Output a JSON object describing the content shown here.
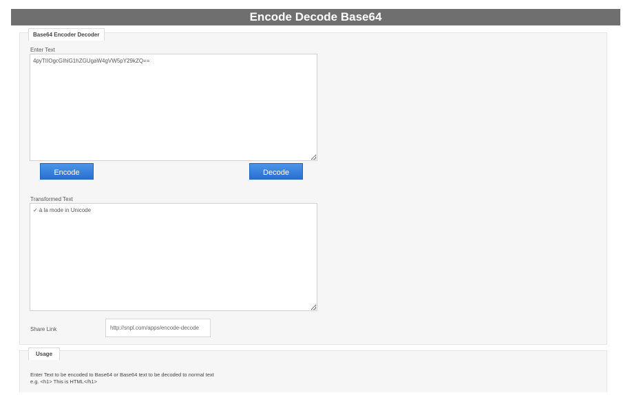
{
  "header": {
    "title": "Encode Decode Base64"
  },
  "panel": {
    "legend": "Base64 Encoder Decoder"
  },
  "input": {
    "label": "Enter Text",
    "value": "4pyTIIOgcGIhiG1hZGUgaW4gVW5pY29kZQ=="
  },
  "buttons": {
    "encode_label": "Encode",
    "decode_label": "Decode"
  },
  "output": {
    "label": "Transformed Text",
    "value": "✓ à la mode in Unicode"
  },
  "share": {
    "label": "Share Link",
    "value": "http://snpl.com/apps/encode-decode"
  },
  "usage": {
    "legend": "Usage",
    "line1": "Enter Text to be encoded to Base64 or Base64 text to be decoded to normal text",
    "line2": "e.g. <h1> This is HTML</h1>"
  }
}
